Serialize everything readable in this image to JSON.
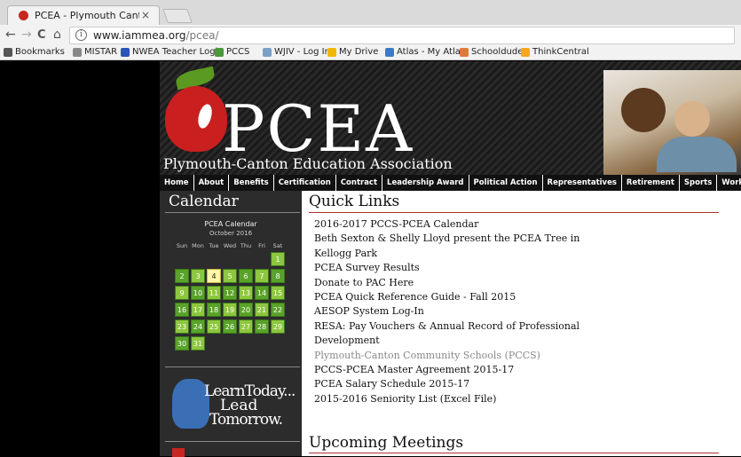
{
  "browser": {
    "tab_title": "PCEA - Plymouth Canto",
    "tab_close": "×",
    "url_host": "www.iammea.org",
    "url_path": "/pcea/",
    "nav_back": "←",
    "nav_forward": "→",
    "nav_reload": "C",
    "nav_home": "⌂",
    "info": "i",
    "bookmarks": [
      {
        "label": "Bookmarks",
        "color": "#555555",
        "icon": "star-icon"
      },
      {
        "label": "MISTAR",
        "color": "#888888",
        "icon": "page-icon"
      },
      {
        "label": "NWEA Teacher Login",
        "color": "#2a55b5",
        "icon": "nwea-icon"
      },
      {
        "label": "PCCS",
        "color": "#4a9a3a",
        "icon": "pccs-icon"
      },
      {
        "label": "WJIV - Log In",
        "color": "#7aa0c8",
        "icon": "page-icon"
      },
      {
        "label": "My Drive",
        "color": "#f2b705",
        "icon": "drive-icon"
      },
      {
        "label": "Atlas - My Atlas",
        "color": "#3a7ac8",
        "icon": "atlas-icon"
      },
      {
        "label": "Schooldude",
        "color": "#e07a3a",
        "icon": "schooldude-icon"
      },
      {
        "label": "ThinkCentral",
        "color": "#f5a623",
        "icon": "thinkcentral-icon"
      }
    ]
  },
  "header": {
    "logo_text": "PCEA",
    "org_name": "Plymouth-Canton Education Association"
  },
  "nav": [
    "Home",
    "About",
    "Benefits",
    "Certification",
    "Contract",
    "Leadership Award",
    "Political Action",
    "Representatives",
    "Retirement",
    "Sports",
    "Workplace"
  ],
  "sidebar": {
    "heading": "Calendar",
    "cal_name": "PCEA Calendar",
    "cal_month": "October 2016",
    "weekdays": [
      "Sun",
      "Mon",
      "Tue",
      "Wed",
      "Thu",
      "Fri",
      "Sat"
    ],
    "leading_blanks": 6,
    "days": [
      "1",
      "2",
      "3",
      "4",
      "5",
      "6",
      "7",
      "8",
      "9",
      "10",
      "11",
      "12",
      "13",
      "14",
      "15",
      "16",
      "17",
      "18",
      "19",
      "20",
      "21",
      "22",
      "23",
      "24",
      "25",
      "26",
      "27",
      "28",
      "29",
      "30",
      "31"
    ],
    "today": "4",
    "learn_line1": "LearnToday...",
    "learn_line2": "Lead",
    "learn_line3": "Tomorrow."
  },
  "main": {
    "quick_links_heading": "Quick Links",
    "links": [
      "2016-2017 PCCS-PCEA Calendar",
      "Beth Sexton & Shelly Lloyd present the PCEA Tree in Kellogg Park",
      "PCEA Survey Results",
      "Donate to PAC Here",
      "PCEA Quick Reference Guide - Fall 2015",
      "AESOP System Log-In",
      "RESA: Pay Vouchers & Annual Record of Professional Development",
      "Plymouth-Canton Community Schools (PCCS)",
      "PCCS-PCEA Master Agreement 2015-17",
      "PCEA Salary Schedule 2015-17",
      "2015-2016 Seniority List (Excel File)"
    ],
    "visited_index": 7,
    "meetings_heading": "Upcoming Meetings"
  }
}
